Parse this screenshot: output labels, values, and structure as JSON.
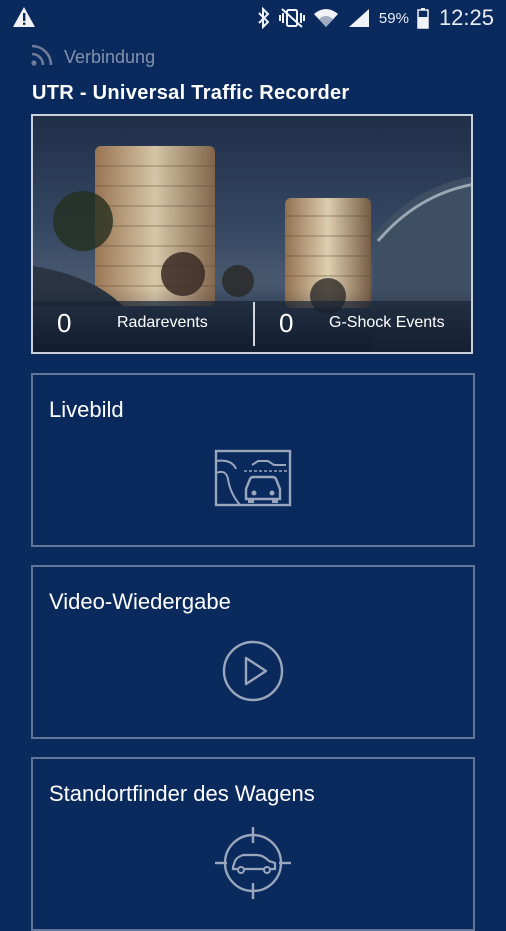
{
  "status_bar": {
    "battery_percent": "59%",
    "time": "12:25",
    "icons": [
      "warning-icon",
      "bluetooth-icon",
      "vibrate-mute-icon",
      "wifi-icon",
      "signal-icon",
      "battery-icon"
    ]
  },
  "header": {
    "connection_label": "Verbindung",
    "app_title": "UTR - Universal Traffic Recorder"
  },
  "hero": {
    "radar_count": "0",
    "radar_label": "Radarevents",
    "gshock_count": "0",
    "gshock_label": "G-Shock Events"
  },
  "cards": [
    {
      "title": "Livebild",
      "icon": "live-view-car-icon"
    },
    {
      "title": "Video-Wiedergabe",
      "icon": "play-icon"
    },
    {
      "title": "Standortfinder des Wagens",
      "icon": "car-locator-icon"
    }
  ],
  "colors": {
    "background": "#0a2a5e",
    "card_border": "#5f7699",
    "hero_border": "#c9d0dc",
    "muted_text": "#8391ad"
  }
}
